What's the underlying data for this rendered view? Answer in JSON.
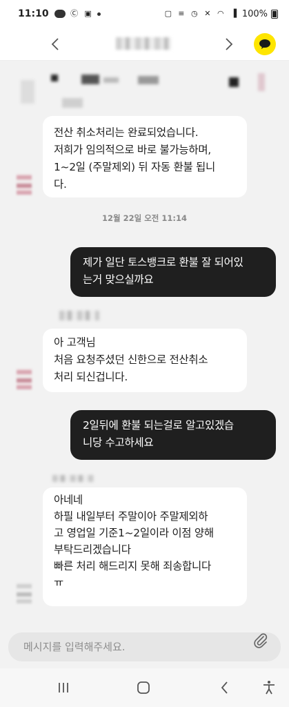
{
  "status_bar": {
    "time": "11:10",
    "battery": "100%"
  },
  "header": {
    "prev_icon": "chevron-left-icon",
    "next_icon": "chevron-right-icon",
    "chat_icon": "kakao-talk-icon",
    "accent_color": "#FEE500"
  },
  "messages": [
    {
      "direction": "in",
      "text": "전산 취소처리는 완료되었습니다.\n저희가 임의적으로 바로 불가능하며,\n1~2일 (주말제외) 뒤 자동 환불 됩니\n다."
    },
    {
      "direction": "separator",
      "text": "12월 22일 오전 11:14"
    },
    {
      "direction": "out",
      "text": "제가 일단 토스뱅크로 환불 잘 되어있\n는거 맞으실까요"
    },
    {
      "direction": "in",
      "text": "아 고객님\n처음 요청주셨던 신한으로 전산취소\n처리 되신겁니다."
    },
    {
      "direction": "out",
      "text": "2일뒤에 환불 되는걸로 알고있겠습\n니당 수고하세요"
    },
    {
      "direction": "in",
      "text": "아네네\n하필 내일부터 주말이아 주말제외하\n고 영업일 기준1~2일이라 이점 양해\n부탁드리겠습니다\n빠른 처리 해드리지 못해 죄송합니다\nㅠ"
    }
  ],
  "input": {
    "placeholder": "메시지를 입력해주세요."
  }
}
